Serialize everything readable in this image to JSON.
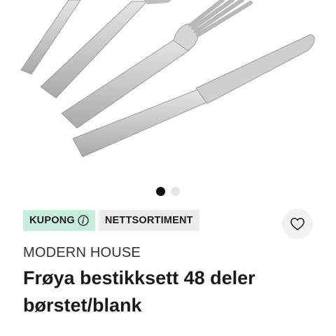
{
  "product": {
    "image_alt": "bestikk",
    "carousel": {
      "count": 2,
      "active_index": 0
    },
    "badges": {
      "coupon_label": "KUPONG",
      "net_label": "NETTSORTIMENT"
    },
    "favorite_icon": "heart-icon",
    "brand": "MODERN HOUSE",
    "title": "Frøya bestikksett 48 deler børstet/blank"
  },
  "colors": {
    "coupon_badge_bg": "#c9eedd",
    "net_badge_bg": "#ececec",
    "dot_active": "#111111",
    "dot_inactive": "#e6e6e6"
  }
}
